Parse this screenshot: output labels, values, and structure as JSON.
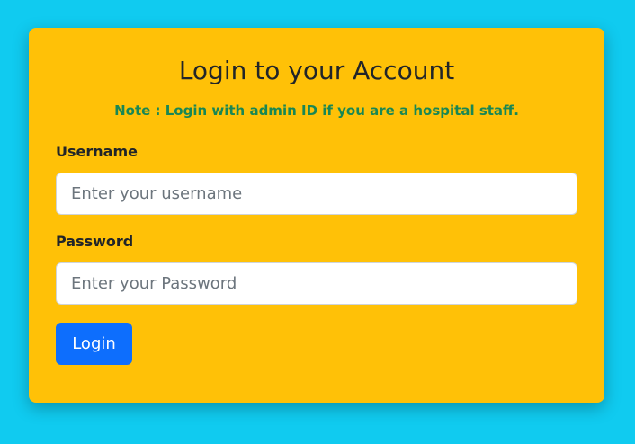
{
  "login_card": {
    "title": "Login to your Account",
    "note": "Note : Login with admin ID if you are a hospital staff.",
    "username": {
      "label": "Username",
      "value": "",
      "placeholder": "Enter your username"
    },
    "password": {
      "label": "Password",
      "value": "",
      "placeholder": "Enter your Password"
    },
    "login_button_label": "Login"
  },
  "colors": {
    "page_background": "#10cbf0",
    "card_background": "#ffc107",
    "note_text": "#198754",
    "primary_button": "#0d6efd"
  }
}
